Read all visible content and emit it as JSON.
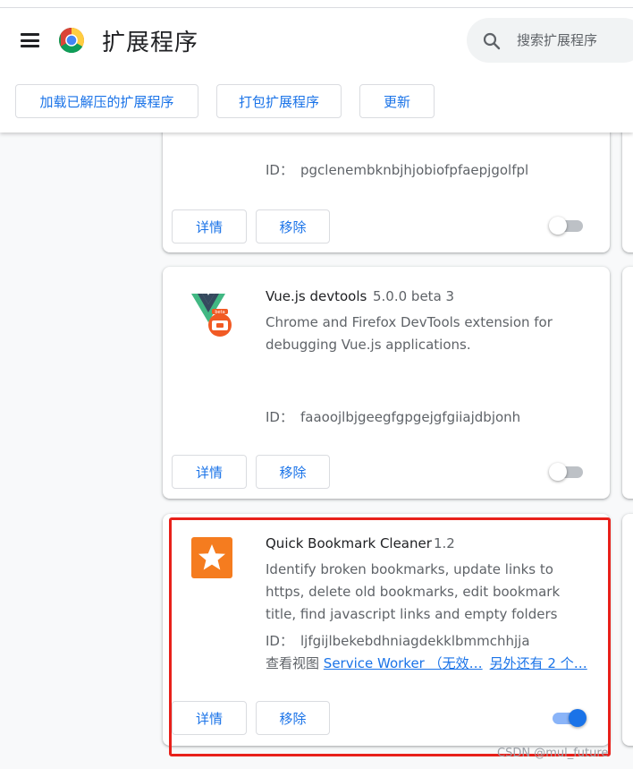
{
  "header": {
    "title": "扩展程序",
    "search_placeholder": "搜索扩展程序",
    "buttons": {
      "load_unpacked": "加载已解压的扩展程序",
      "pack": "打包扩展程序",
      "update": "更新"
    }
  },
  "extensions": [
    {
      "id_label": "ID：",
      "id": "pgclenembknbjhjobiofpfaepjgolfpl",
      "details_label": "详情",
      "remove_label": "移除",
      "enabled": false
    },
    {
      "name": "Vue.js devtools",
      "version": "5.0.0 beta 3",
      "description": "Chrome and Firefox DevTools extension for debugging Vue.js applications.",
      "id_label": "ID：",
      "id": "faaoojlbjgeegfgpgejgfgiiajdbjonh",
      "icon_badge": "beta",
      "details_label": "详情",
      "remove_label": "移除",
      "enabled": false
    },
    {
      "name": "Quick Bookmark Cleaner",
      "version": "1.2",
      "description": "Identify broken bookmarks, update links to https, delete old bookmarks, edit bookmark title, find javascript links and empty folders",
      "id_label": "ID：",
      "id": "ljfgijlbekebdhniagdekklbmmchhjja",
      "views_label": "查看视图",
      "views_link": "Service Worker （无效…",
      "views_more": "另外还有 2 个…",
      "details_label": "详情",
      "remove_label": "移除",
      "enabled": true
    }
  ],
  "watermark": "CSDN @mul_future",
  "colors": {
    "accent": "#1a73e8",
    "highlight": "#e8201a",
    "toggle_off": "#bdc1c6",
    "toggle_on_track": "#8ab4f8"
  }
}
